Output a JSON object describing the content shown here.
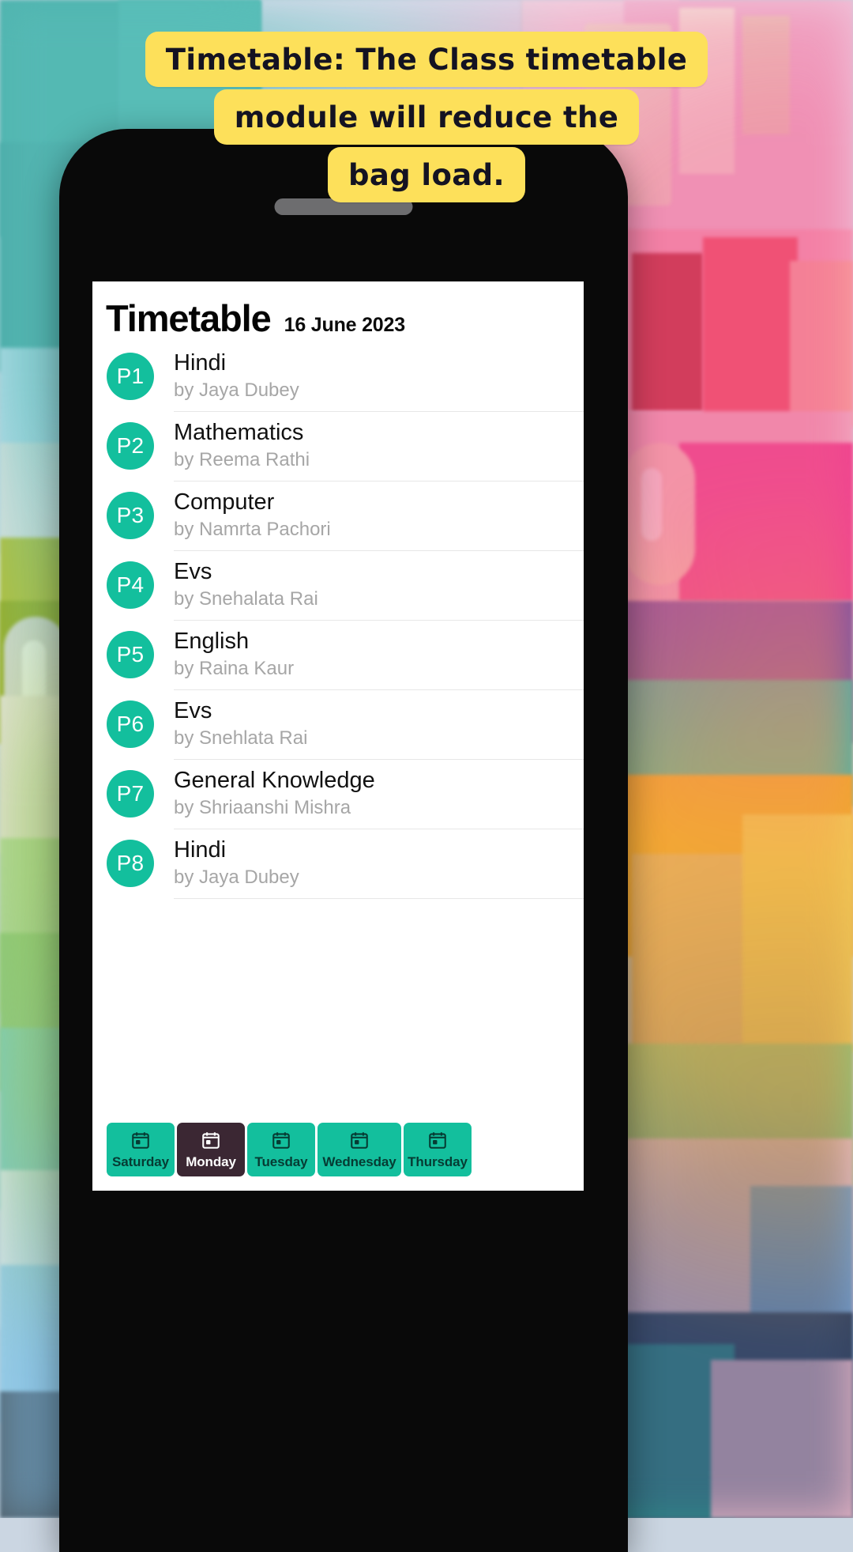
{
  "caption": {
    "lines": [
      "Timetable: The Class timetable",
      "module will reduce the",
      "bag load."
    ],
    "bubble_color": "#fde05a",
    "text_color": "#141322"
  },
  "app": {
    "title": "Timetable",
    "date": "16 June 2023",
    "accent_color": "#13bf9d",
    "active_tab_color": "#3b2733"
  },
  "periods": [
    {
      "badge": "P1",
      "subject": "Hindi",
      "teacher": "by Jaya Dubey"
    },
    {
      "badge": "P2",
      "subject": "Mathematics",
      "teacher": "by Reema Rathi"
    },
    {
      "badge": "P3",
      "subject": "Computer",
      "teacher": "by Namrta Pachori"
    },
    {
      "badge": "P4",
      "subject": "Evs",
      "teacher": "by Snehalata Rai"
    },
    {
      "badge": "P5",
      "subject": "English",
      "teacher": "by Raina Kaur"
    },
    {
      "badge": "P6",
      "subject": "Evs",
      "teacher": "by Snehlata Rai"
    },
    {
      "badge": "P7",
      "subject": "General Knowledge",
      "teacher": "by Shriaanshi Mishra"
    },
    {
      "badge": "P8",
      "subject": "Hindi",
      "teacher": "by Jaya Dubey"
    }
  ],
  "tabs": [
    {
      "label": "Saturday",
      "icon": "calendar-icon",
      "active": false
    },
    {
      "label": "Monday",
      "icon": "calendar-icon",
      "active": true
    },
    {
      "label": "Tuesday",
      "icon": "calendar-icon",
      "active": false
    },
    {
      "label": "Wednesday",
      "icon": "calendar-icon",
      "active": false
    },
    {
      "label": "Thursday",
      "icon": "calendar-icon",
      "active": false
    }
  ]
}
